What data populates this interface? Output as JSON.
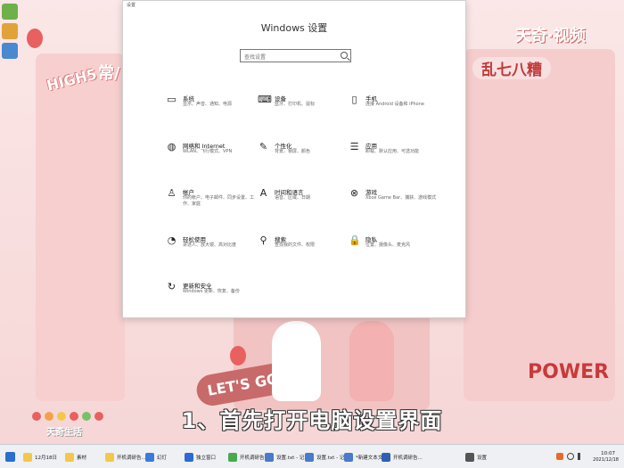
{
  "wallpaper": {
    "brand": "天奇·视频",
    "high5": "HIGH5",
    "chang": "常/",
    "luan": "乱七八糟",
    "power": "POWER",
    "letsgo": "LET'S GO!!!",
    "watermark": "天奇生活"
  },
  "window": {
    "title_bar": "设置",
    "heading": "Windows 设置",
    "search_placeholder": "查找设置"
  },
  "tiles": [
    {
      "name": "系统",
      "desc": "显示、声音、通知、电源",
      "icon": "monitor-icon"
    },
    {
      "name": "设备",
      "desc": "蓝牙、打印机、鼠标",
      "icon": "devices-icon"
    },
    {
      "name": "手机",
      "desc": "连接 Android 设备和 iPhone",
      "icon": "phone-icon"
    },
    {
      "name": "网络和 Internet",
      "desc": "WLAN、飞行模式、VPN",
      "icon": "globe-icon"
    },
    {
      "name": "个性化",
      "desc": "背景、锁屏、颜色",
      "icon": "brush-icon"
    },
    {
      "name": "应用",
      "desc": "卸载、默认应用、可选功能",
      "icon": "apps-list-icon"
    },
    {
      "name": "帐户",
      "desc": "你的帐户、电子邮件、同步设置、工作、家庭",
      "icon": "person-icon"
    },
    {
      "name": "时间和语言",
      "desc": "语音、区域、日期",
      "icon": "time-language-icon"
    },
    {
      "name": "游戏",
      "desc": "Xbox Game Bar、捕获、游戏模式",
      "icon": "xbox-icon"
    },
    {
      "name": "轻松使用",
      "desc": "讲述人、放大镜、高对比度",
      "icon": "ease-of-access-icon"
    },
    {
      "name": "搜索",
      "desc": "查找我的文件、权限",
      "icon": "search-icon"
    },
    {
      "name": "隐私",
      "desc": "位置、摄像头、麦克风",
      "icon": "lock-icon"
    },
    {
      "name": "更新和安全",
      "desc": "Windows 更新、恢复、备份",
      "icon": "update-icon"
    }
  ],
  "subtitle": "1、首先打开电脑设置界面",
  "taskbar": {
    "items": [
      {
        "label": "12月18日",
        "color": "#f3c84a"
      },
      {
        "label": "素材",
        "color": "#f3c84a"
      },
      {
        "label": "开机调研告...",
        "color": "#f3c84a"
      },
      {
        "label": "幻灯",
        "color": "#3b7bd8"
      },
      {
        "label": "独立窗口",
        "color": "#2e6bd0"
      },
      {
        "label": "开机调研告...",
        "color": "#4aa84f"
      },
      {
        "label": "设置.txt - 记...",
        "color": "#4a7ac8"
      },
      {
        "label": "设置.txt - 记...",
        "color": "#4a7ac8"
      },
      {
        "label": "*新建文本文...",
        "color": "#4a7ac8"
      },
      {
        "label": "开机调研告...",
        "color": "#2e5fb5"
      },
      {
        "label": "设置",
        "color": "#555555"
      }
    ],
    "time": "10:07",
    "date": "2021/12/18"
  }
}
